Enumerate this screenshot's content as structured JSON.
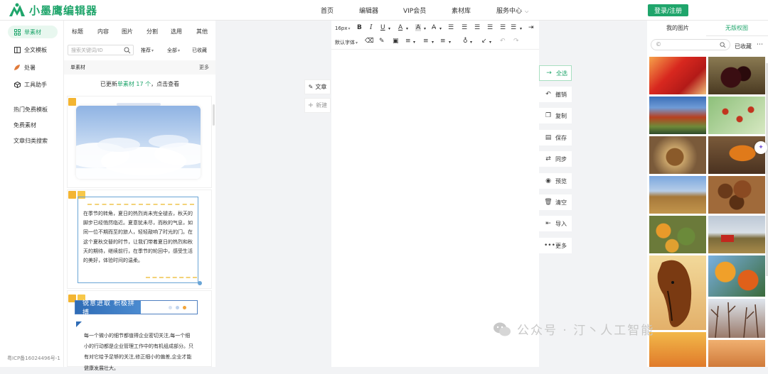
{
  "brand": {
    "name": "小墨鹰编辑器",
    "color": "#1fa56b"
  },
  "topnav": {
    "items": [
      "首页",
      "编辑器",
      "VIP会员",
      "素材库",
      "服务中心"
    ],
    "login_label": "登录/注册"
  },
  "left_sidebar": {
    "items": [
      {
        "label": "单素材",
        "icon": "grid-icon",
        "active": true
      },
      {
        "label": "全文模板",
        "icon": "layout-icon",
        "active": false
      },
      {
        "label": "处暑",
        "icon": "leaf-icon",
        "active": false
      },
      {
        "label": "工具助手",
        "icon": "cube-icon",
        "active": false
      }
    ],
    "links": [
      "热门免费模板",
      "免费素材",
      "文章归类搜索"
    ],
    "icp": "粤ICP备16024496号-1"
  },
  "material": {
    "tabs": [
      "标题",
      "内容",
      "图片",
      "分割",
      "选用",
      "其他"
    ],
    "search_placeholder": "搜索关键词/ID",
    "filters": [
      "推荐",
      "全部",
      "已收藏"
    ],
    "section_label": "单素材",
    "more_label": "更多",
    "update_prefix": "已更新",
    "update_highlight": "单素材 17 个",
    "update_suffix": "，点击查看",
    "poem": "在季节的转角，夏日的热烈尚未完全褪去，秋天的脚步已经悄然临近。夏意犹未尽，而秋的气息，如同一位不期而至的旅人，轻轻敲响了时光的门。在这个夏秋交替的时节，让我们带着夏日的热烈和秋天的期待，继续前行，在季节的轮回中，感受生活的美好，体验时间的温柔。",
    "banner": "锐意进取 积极拼搏",
    "para": "每一个微小的细节都值得企业密切关注,每一个细小的行动都是企业管理工作中的有机组成部分。只有对它给予足够的关注,修正细小的偏差,企业才能健康发展壮大。"
  },
  "float_tabs": [
    "文章",
    "新建"
  ],
  "toolbar": {
    "font_size": "16px",
    "font_family": "默认字体"
  },
  "actions": [
    "全选",
    "撤销",
    "复制",
    "保存",
    "同步",
    "预览",
    "清空",
    "导入",
    "更多"
  ],
  "right_panel": {
    "tabs": [
      "我的图片",
      "无版权图"
    ],
    "fav_label": "已收藏",
    "search_value": "©"
  },
  "watermark": "公众号 · 汀丶人工智能"
}
